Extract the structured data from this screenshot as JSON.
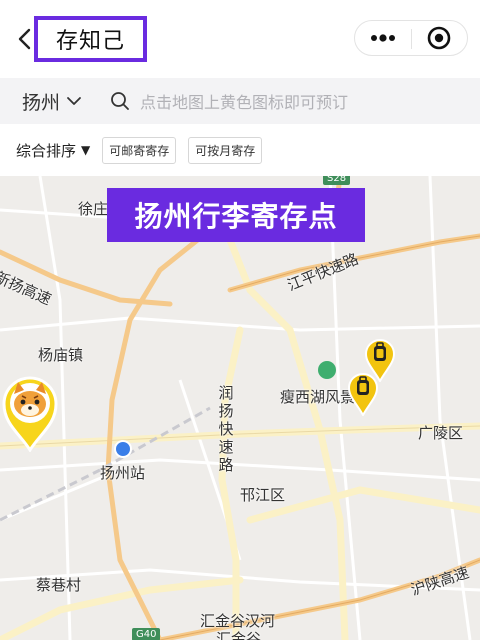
{
  "nav": {
    "title": "存知己",
    "back_icon": "chevron-left-icon",
    "more_icon": "more-dots-icon",
    "close_icon": "target-circle-icon"
  },
  "search": {
    "city": "扬州",
    "placeholder": "点击地图上黄色图标即可预订"
  },
  "filters": {
    "sort_label": "综合排序",
    "chips": [
      "可邮寄寄存",
      "可按月寄存"
    ]
  },
  "banner": {
    "text": "扬州行李寄存点"
  },
  "map": {
    "labels": {
      "xuzhuang": "徐庄",
      "xinyang_highway": "新扬高速",
      "jiangping_expressway": "江平快速路",
      "yangmiao": "杨庙镇",
      "runyang_expressway": "润扬快速路",
      "slender_west_lake": "瘦西湖风景区",
      "guangling": "广陵区",
      "yangzhou_station": "扬州站",
      "hanjiang": "邗江区",
      "caixiang": "蔡巷村",
      "hushan_highway": "沪陕高速",
      "huijin": "汇金谷汉河",
      "huijin2": "汇金谷"
    },
    "shields": {
      "s28": "S28",
      "g40": "G40"
    },
    "colors": {
      "accent": "#6a2be0",
      "pin_yellow": "#f2c40f",
      "highway": "#f5c98a",
      "main_road": "#fbf1c6"
    }
  }
}
